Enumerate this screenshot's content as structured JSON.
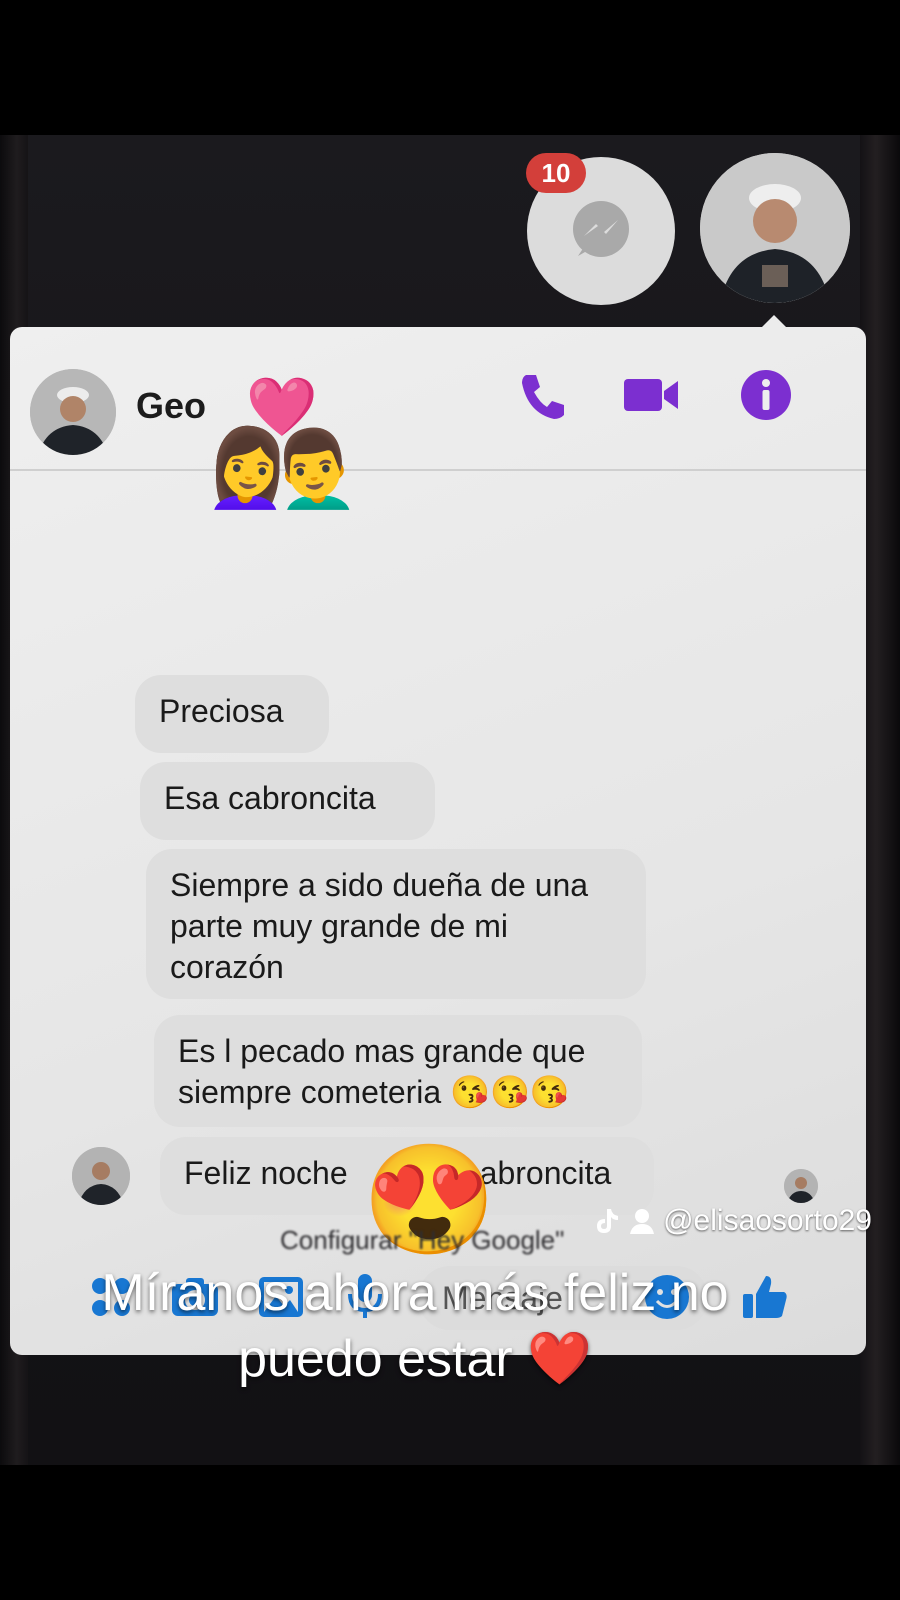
{
  "chat_heads": {
    "messenger_badge": "10"
  },
  "header": {
    "contact_name": "Geo",
    "overlay_emoji": "👩‍❤️‍👨",
    "icons": [
      "phone-icon",
      "video-icon",
      "info-icon"
    ],
    "accent_color": "#7c2fd0"
  },
  "messages": [
    {
      "text": "Preciosa"
    },
    {
      "text": "Esa cabroncita"
    },
    {
      "text": "Siempre a sido dueña de una parte muy grande de mi corazón"
    },
    {
      "text": "Es l pecado mas grande que siempre cometeria 😘😘😘"
    },
    {
      "text_before": "Feliz noche",
      "text_after": "cabroncita"
    }
  ],
  "overlay_emoji": "😍",
  "composer": {
    "placeholder": "Mensaje",
    "icons": [
      "apps-icon",
      "camera-icon",
      "gallery-icon",
      "mic-icon",
      "emoji-icon",
      "like-icon"
    ],
    "icon_color": "#1877d2"
  },
  "background_text": "Configurar \"Hey Google\"",
  "tiktok": {
    "handle": "@elisaosorto29",
    "caption": "Míranos ahora más feliz no puedo estar ❤️"
  }
}
